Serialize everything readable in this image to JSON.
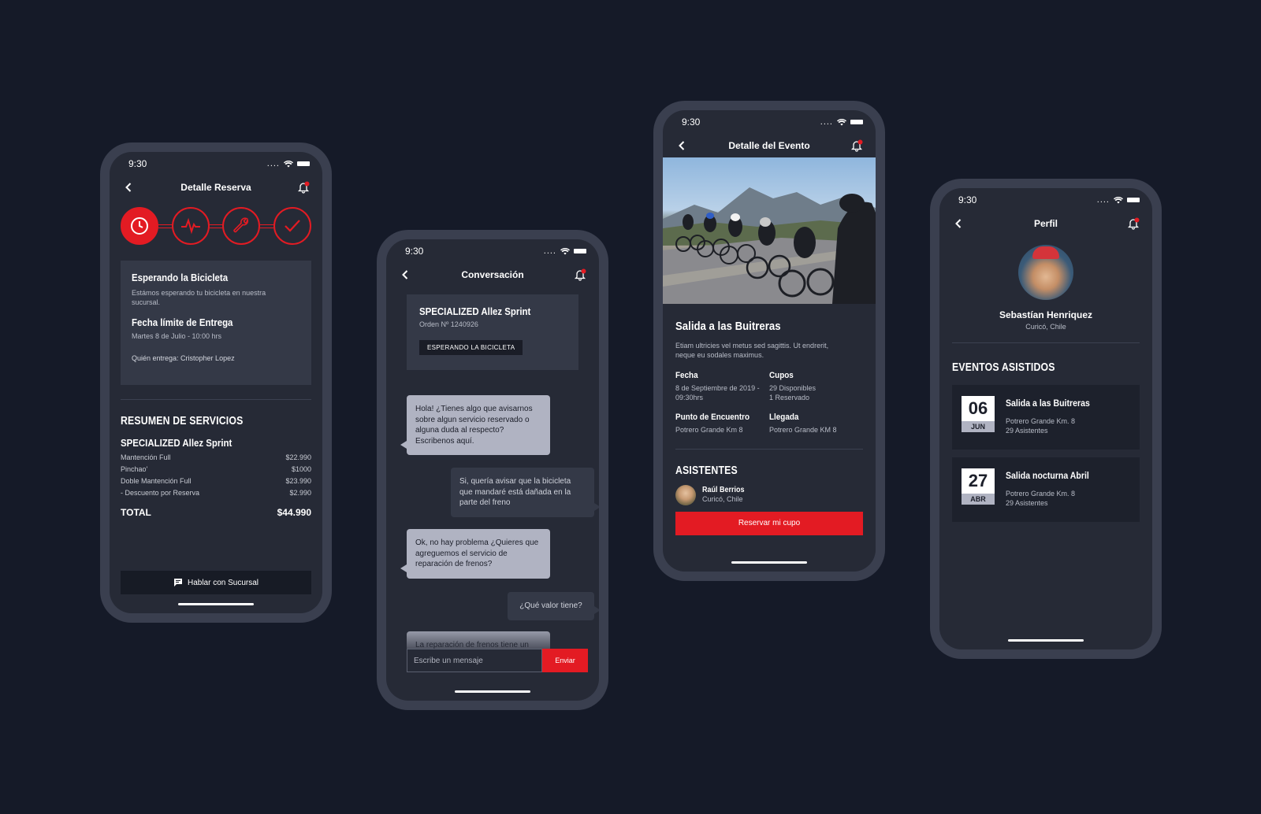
{
  "status_time": "9:30",
  "status_dots": "....",
  "colors": {
    "accent": "#e31b23",
    "background": "#151a28",
    "screen": "#262a36",
    "card": "#343947"
  },
  "reserva": {
    "title": "Detalle Reserva",
    "steps": [
      "clock-icon",
      "pulse-icon",
      "wrench-icon",
      "check-icon"
    ],
    "status_title": "Esperando la Bicicleta",
    "status_desc": "Estámos esperando tu bicicleta en nuestra sucursal.",
    "deadline_title": "Fecha límite de Entrega",
    "deadline_value": "Martes 8 de Julio - 10:00 hrs",
    "delivered_by": "Quién entrega: Cristopher Lopez",
    "summary_title": "RESUMEN DE SERVICIOS",
    "bike_name": "SPECIALIZED Allez Sprint",
    "items": [
      {
        "name": "Mantención Full",
        "price": "$22.990"
      },
      {
        "name": "Pinchao'",
        "price": "$1000"
      },
      {
        "name": "Doble Mantención Full",
        "price": "$23.990"
      },
      {
        "name": "- Descuento por Reserva",
        "price": "$2.990"
      }
    ],
    "total_label": "TOTAL",
    "total_value": "$44.990",
    "talk_button": "Hablar con Sucursal"
  },
  "conversacion": {
    "title": "Conversación",
    "bike_name": "SPECIALIZED Allez Sprint",
    "order": "Orden Nº 1240926",
    "badge": "ESPERANDO LA BICICLETA",
    "messages": [
      "Hola! ¿Tienes algo que avisarnos sobre algun servicio reservado o alguna duda al respecto? Escribenos aquí.",
      "Si, quería avisar que la bicicleta que mandaré está dañada en la parte del freno",
      "Ok, no hay problema ¿Quieres que agreguemos el servicio de reparación de frenos?",
      "¿Qué valor tiene?",
      "La reparación de frenos tiene un"
    ],
    "input_placeholder": "Escribe un mensaje",
    "send_label": "Enviar"
  },
  "evento": {
    "title": "Detalle del Evento",
    "name": "Salida a las Buitreras",
    "desc": "Etiam ultricies vel metus sed sagittis. Ut endrerit, neque eu sodales maximus.",
    "fecha_label": "Fecha",
    "fecha_value": "8 de Septiembre de 2019 - 09:30hrs",
    "cupos_label": "Cupos",
    "cupos_disp": "29 Disponibles",
    "cupos_res": "1 Reservado",
    "punto_label": "Punto de Encuentro",
    "punto_value": "Potrero Grande Km 8",
    "llegada_label": "Llegada",
    "llegada_value": "Potrero Grande KM 8",
    "asistentes_title": "ASISTENTES",
    "attendee_name": "Raúl Berrios",
    "attendee_loc": "Curicó, Chile",
    "reserve_button": "Reservar mi cupo"
  },
  "perfil": {
    "title": "Perfil",
    "name": "Sebastían Henriquez",
    "location": "Curicó, Chile",
    "section_title": "EVENTOS ASISTIDOS",
    "events": [
      {
        "day": "06",
        "month": "JUN",
        "name": "Salida a las Buitreras",
        "place": "Potrero Grande Km. 8",
        "attendees": "29 Asistentes"
      },
      {
        "day": "27",
        "month": "ABR",
        "name": "Salida nocturna Abril",
        "place": "Potrero Grande Km. 8",
        "attendees": "29 Asistentes"
      }
    ]
  }
}
